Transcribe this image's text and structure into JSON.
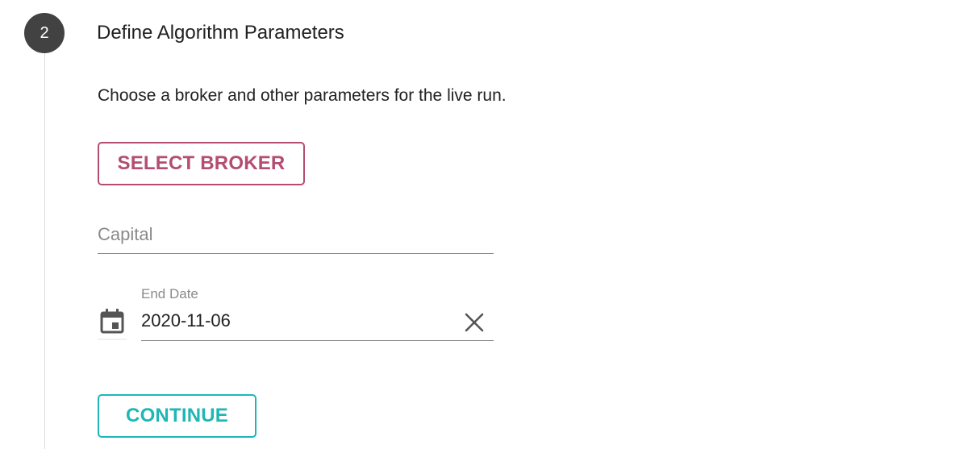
{
  "step": {
    "number": "2",
    "title": "Define Algorithm Parameters",
    "description": "Choose a broker and other parameters for the live run."
  },
  "broker_button": {
    "label": "SELECT BROKER",
    "color": "#b34d72"
  },
  "capital": {
    "placeholder": "Capital",
    "value": ""
  },
  "end_date": {
    "label": "End Date",
    "value": "2020-11-06",
    "icon": "calendar-icon",
    "clear_icon": "close-icon"
  },
  "continue_button": {
    "label": "CONTINUE",
    "color": "#1fb6b6"
  }
}
